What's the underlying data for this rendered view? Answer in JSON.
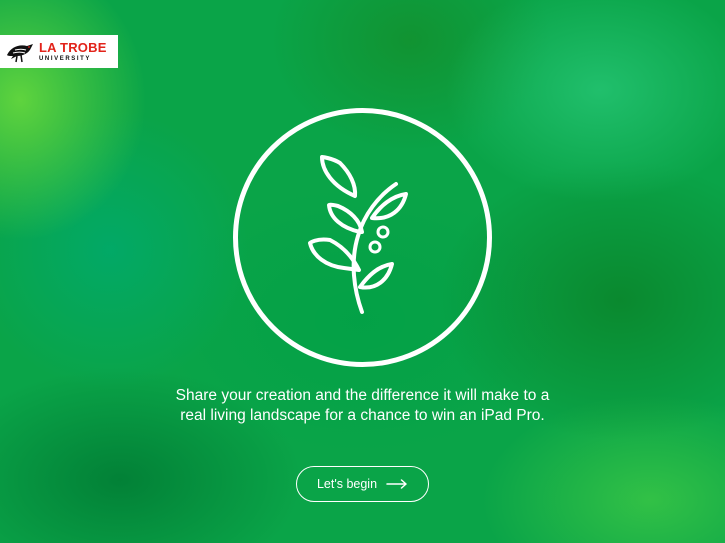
{
  "brand": {
    "name": "LA TROBE",
    "subtitle": "UNIVERSITY",
    "logo_icon": "latrobe-bird-icon",
    "color": "#e2231a"
  },
  "hero": {
    "icon": "plant-sprig-icon",
    "message_line1": "Share your creation and the difference it will make to a",
    "message_line2": "real living landscape for a chance to win an iPad Pro."
  },
  "cta": {
    "label": "Let's begin",
    "icon": "arrow-right-icon"
  },
  "theme": {
    "background": "#0aa448",
    "foreground": "#ffffff"
  }
}
